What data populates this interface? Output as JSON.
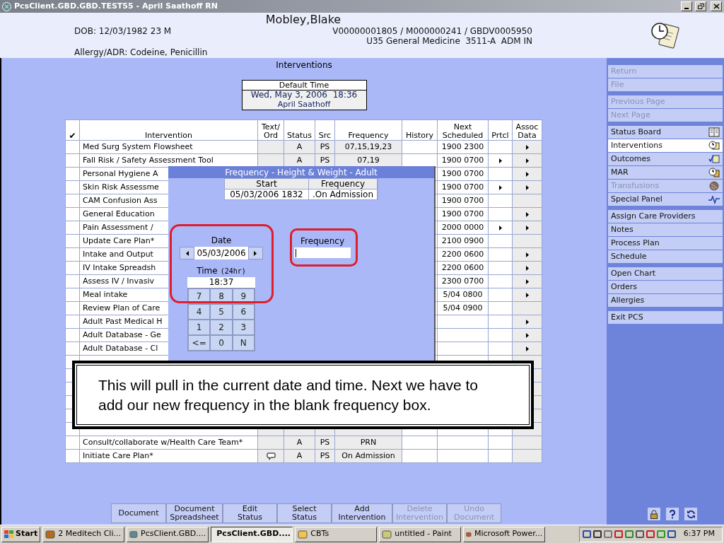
{
  "window": {
    "title": "PcsClient.GBD.GBD.TEST55 - April Saathoff RN"
  },
  "patient": {
    "name": "Mobley,Blake",
    "dob": "DOB: 12/03/1982 23 M",
    "ids": "V00000001805 / M000000241 / GBDV0005950",
    "location": "U35 General Medicine  3511-A  ADM IN",
    "allergy": "Allergy/ADR: Codeine, Penicillin"
  },
  "page_title": "Interventions",
  "default_time": {
    "label": "Default Time",
    "datetime": "Wed, May 3, 2006  18:36",
    "user": "April Saathoff"
  },
  "table": {
    "columns": [
      "✔",
      "Intervention",
      "Text/ Ord",
      "Status",
      "Src",
      "Frequency",
      "History",
      "Next Scheduled",
      "Prtcl",
      "Assoc Data"
    ],
    "rows": [
      {
        "intervention": "Med Surg System Flowsheet",
        "status": "A",
        "src": "PS",
        "frequency": "07,15,19,23",
        "next": "1900 2300",
        "protocol": false,
        "assoc": true,
        "note": false
      },
      {
        "intervention": "Fall Risk / Safety Assessment Tool",
        "status": "A",
        "src": "PS",
        "frequency": "07,19",
        "next": "1900 0700",
        "protocol": true,
        "assoc": true,
        "note": false
      },
      {
        "intervention": "Personal Hygiene A",
        "next": "1900 0700",
        "protocol": false,
        "assoc": true,
        "note": false
      },
      {
        "intervention": "Skin Risk Assessme",
        "next": "1900 0700",
        "protocol": true,
        "assoc": true,
        "note": false
      },
      {
        "intervention": "CAM Confusion Ass",
        "next": "1900 0700",
        "protocol": false,
        "assoc": false,
        "note": false
      },
      {
        "intervention": "General Education",
        "next": "1900 0700",
        "protocol": false,
        "assoc": true,
        "note": false
      },
      {
        "intervention": "Pain Assessment /",
        "next": "2000 0000",
        "protocol": true,
        "assoc": true,
        "note": false
      },
      {
        "intervention": "Update Care Plan*",
        "next": "2100 0900",
        "protocol": false,
        "assoc": false,
        "note": false
      },
      {
        "intervention": "Intake and Output",
        "next": "2200 0600",
        "protocol": false,
        "assoc": true,
        "note": false
      },
      {
        "intervention": "IV Intake Spreadsh",
        "next": "2200 0600",
        "protocol": false,
        "assoc": true,
        "note": false
      },
      {
        "intervention": "Assess IV / Invasiv",
        "next": "2300 0700",
        "protocol": false,
        "assoc": true,
        "note": false
      },
      {
        "intervention": "Meal intake",
        "next": "5/04 0800",
        "protocol": false,
        "assoc": true,
        "note": false
      },
      {
        "intervention": "Review Plan of Care",
        "next": "5/04 0900",
        "protocol": false,
        "assoc": false,
        "note": false
      },
      {
        "intervention": "Adult Past Medical H",
        "protocol": false,
        "assoc": true,
        "note": false
      },
      {
        "intervention": "Adult Database - Ge",
        "protocol": false,
        "assoc": true,
        "note": false
      },
      {
        "intervention": "Adult Database - Cl",
        "protocol": false,
        "assoc": true,
        "note": false
      },
      {
        "intervention": "Consult/collaborate w/Health Care Team*",
        "status": "A",
        "src": "PS",
        "frequency": "PRN",
        "protocol": false,
        "assoc": false,
        "note": false
      },
      {
        "intervention": "Initiate Care Plan*",
        "status": "A",
        "src": "PS",
        "frequency": "On Admission",
        "protocol": false,
        "assoc": false,
        "note": true
      }
    ]
  },
  "dialog": {
    "title": "Frequency - Height & Weight - Adult",
    "current": {
      "columns": [
        "Start",
        "Frequency"
      ],
      "values": [
        "05/03/2006 1832",
        ".On Admission"
      ]
    },
    "date_label": "Date",
    "date": "05/03/2006",
    "time_label": "Time",
    "time_unit": "(24hr)",
    "time": "18:37",
    "keypad": [
      "7",
      "8",
      "9",
      "4",
      "5",
      "6",
      "1",
      "2",
      "3",
      "<=",
      "0",
      "N"
    ],
    "frequency_label": "Frequency"
  },
  "callout": "This will pull in the current date and time. Next we have to add our new frequency in the blank frequency box.",
  "toolbar": [
    {
      "label": "Document",
      "disabled": false
    },
    {
      "label": "Document\nSpreadsheet",
      "disabled": false
    },
    {
      "label": "Edit\nStatus",
      "disabled": false
    },
    {
      "label": "Select\nStatus",
      "disabled": false
    },
    {
      "label": "Add\nIntervention",
      "disabled": false
    },
    {
      "label": "Delete\nIntervention",
      "disabled": true
    },
    {
      "label": "Undo\nDocument",
      "disabled": true
    }
  ],
  "sidebar": {
    "groups": [
      {
        "items": [
          {
            "label": "Return",
            "disabled": true,
            "selected": false
          },
          {
            "label": "File",
            "disabled": true,
            "selected": false
          }
        ]
      },
      {
        "items": [
          {
            "label": "Previous Page",
            "disabled": true,
            "selected": false
          },
          {
            "label": "Next Page",
            "disabled": true,
            "selected": false
          }
        ]
      },
      {
        "items": [
          {
            "label": "Status Board",
            "disabled": false,
            "selected": false
          },
          {
            "label": "Interventions",
            "disabled": false,
            "selected": true
          },
          {
            "label": "Outcomes",
            "disabled": false,
            "selected": false
          },
          {
            "label": "MAR",
            "disabled": false,
            "selected": false
          },
          {
            "label": "Transfusions",
            "disabled": true,
            "selected": false
          },
          {
            "label": "Special Panel",
            "disabled": false,
            "selected": false
          }
        ]
      },
      {
        "items": [
          {
            "label": "Assign Care Providers",
            "disabled": false,
            "selected": false
          },
          {
            "label": "Notes",
            "disabled": false,
            "selected": false
          },
          {
            "label": "Process Plan",
            "disabled": false,
            "selected": false
          },
          {
            "label": "Schedule",
            "disabled": false,
            "selected": false
          }
        ]
      },
      {
        "items": [
          {
            "label": "Open Chart",
            "disabled": false,
            "selected": false
          },
          {
            "label": "Orders",
            "disabled": false,
            "selected": false
          },
          {
            "label": "Allergies",
            "disabled": false,
            "selected": false
          }
        ]
      },
      {
        "items": [
          {
            "label": "Exit PCS",
            "disabled": false,
            "selected": false
          }
        ]
      }
    ]
  },
  "taskbar": {
    "start": "Start",
    "tasks": [
      {
        "label": "2 Meditech Cli...",
        "selected": false
      },
      {
        "label": "PcsClient.GBD....",
        "selected": false
      },
      {
        "label": "PcsClient.GBD....",
        "selected": true
      },
      {
        "label": "CBTs",
        "selected": false
      },
      {
        "label": "untitled - Paint",
        "selected": false
      },
      {
        "label": "Microsoft Power...",
        "selected": false
      }
    ],
    "clock": "6:37 PM"
  }
}
